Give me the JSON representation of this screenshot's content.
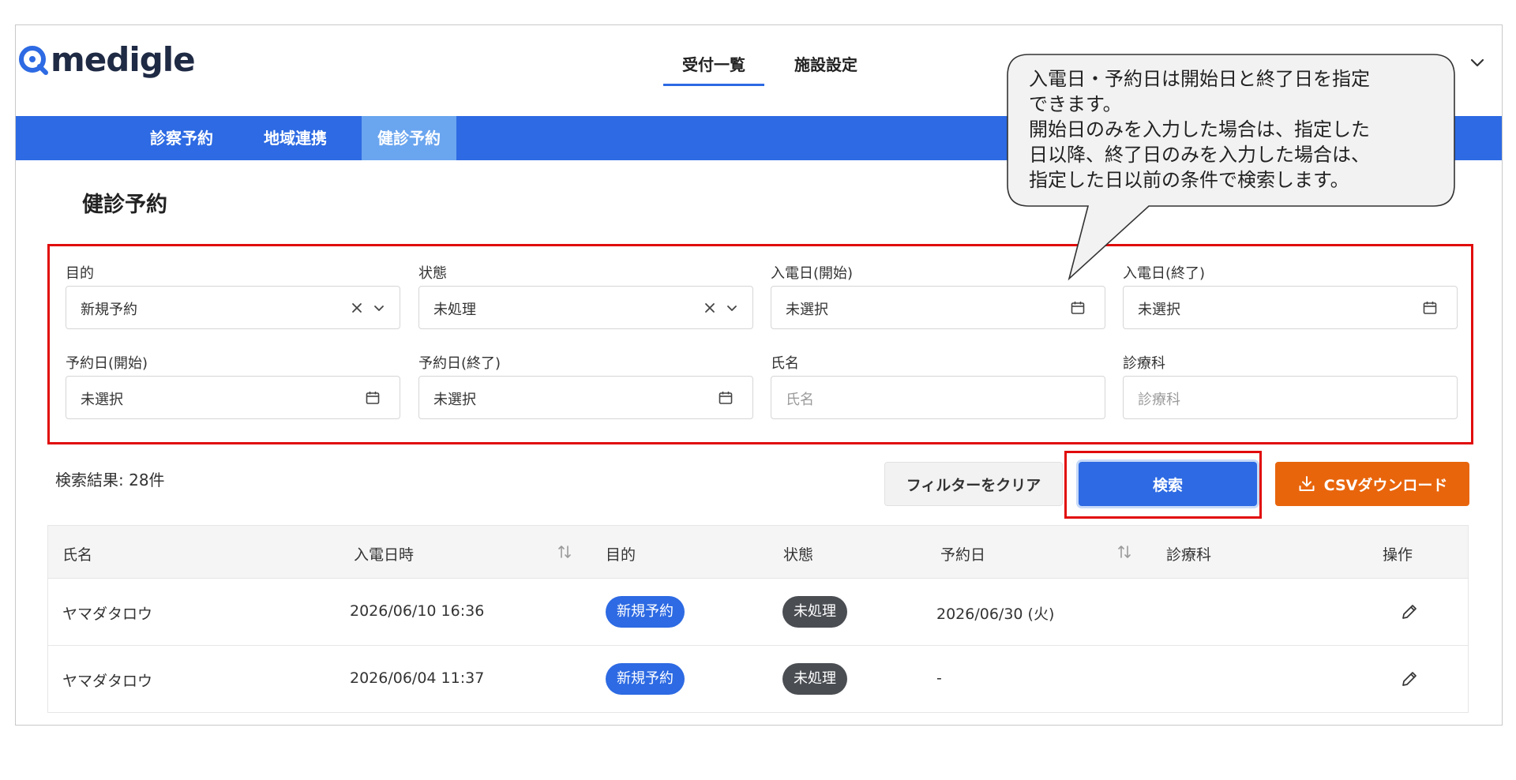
{
  "header": {
    "logo_text": "medigle",
    "nav": [
      {
        "label": "受付一覧",
        "active": true
      },
      {
        "label": "施設設定",
        "active": false
      }
    ]
  },
  "subnav": [
    {
      "label": "診察予約",
      "active": false
    },
    {
      "label": "地域連携",
      "active": false
    },
    {
      "label": "健診予約",
      "active": true
    }
  ],
  "page_title": "健診予約",
  "filters": [
    {
      "label": "目的",
      "value": "新規予約",
      "placeholder": false,
      "control": "select-clear"
    },
    {
      "label": "状態",
      "value": "未処理",
      "placeholder": false,
      "control": "select-clear"
    },
    {
      "label": "入電日(開始)",
      "value": "未選択",
      "placeholder": false,
      "control": "date"
    },
    {
      "label": "入電日(終了)",
      "value": "未選択",
      "placeholder": false,
      "control": "date"
    },
    {
      "label": "予約日(開始)",
      "value": "未選択",
      "placeholder": false,
      "control": "date"
    },
    {
      "label": "予約日(終了)",
      "value": "未選択",
      "placeholder": false,
      "control": "date"
    },
    {
      "label": "氏名",
      "value": "氏名",
      "placeholder": true,
      "control": "text"
    },
    {
      "label": "診療科",
      "value": "診療科",
      "placeholder": true,
      "control": "text"
    }
  ],
  "results": {
    "count_text": "検索結果: 28件",
    "clear_label": "フィルターをクリア",
    "search_label": "検索",
    "csv_label": "CSVダウンロード"
  },
  "table": {
    "headers": [
      "氏名",
      "入電日時",
      "目的",
      "状態",
      "予約日",
      "診療科",
      "操作"
    ],
    "rows": [
      {
        "name": "ヤマダタロウ",
        "call_datetime": "2026/06/10 16:36",
        "purpose": "新規予約",
        "status": "未処理",
        "reservation_date": "2026/06/30 (火)",
        "department": ""
      },
      {
        "name": "ヤマダタロウ",
        "call_datetime": "2026/06/04 11:37",
        "purpose": "新規予約",
        "status": "未処理",
        "reservation_date": "-",
        "department": ""
      }
    ]
  },
  "callout": {
    "lines": [
      "入電日・予約日は開始日と終了日を指定",
      "できます。",
      "開始日のみを入力した場合は、指定した",
      "日以降、終了日のみを入力した場合は、",
      "指定した日以前の条件で検索します。"
    ]
  },
  "colors": {
    "brand_blue": "#2d6ae3",
    "subnav_active": "#6aa5ef",
    "csv_orange": "#e8650c",
    "highlight_red": "#e10b0b",
    "badge_gray": "#4a4d52"
  },
  "icons": [
    "medigle-logo-icon",
    "chevron-down-icon",
    "clear-icon",
    "calendar-icon",
    "sort-icon",
    "download-icon",
    "edit-icon"
  ]
}
